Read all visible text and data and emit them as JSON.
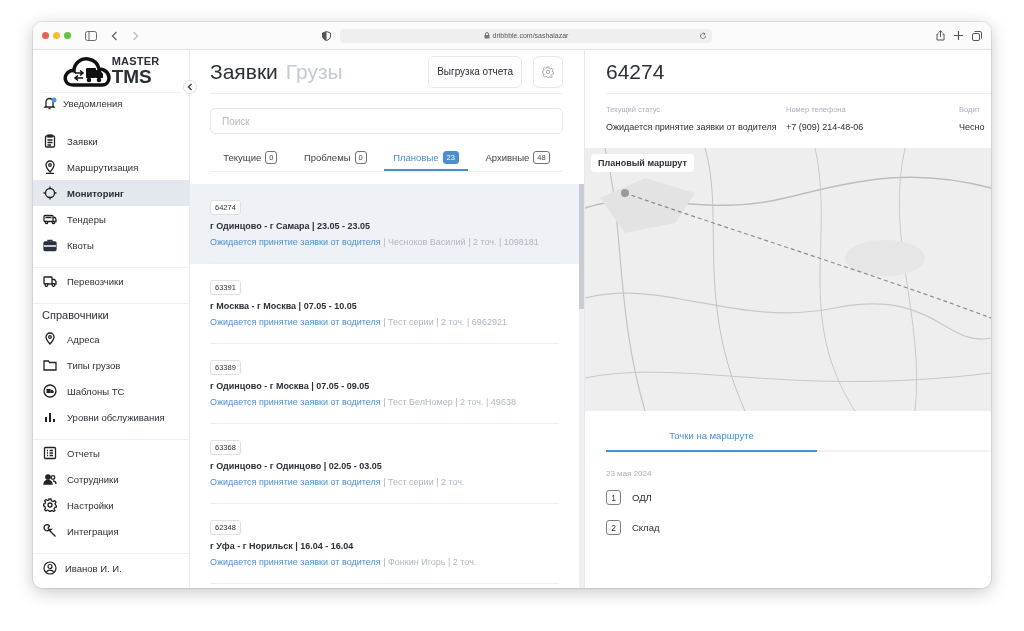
{
  "browser": {
    "url": "dribbble.com/sashalazar"
  },
  "sidebar": {
    "logo": {
      "line1": "MASTER",
      "line2": "TMS"
    },
    "notifications": {
      "label": "Уведомления"
    },
    "groups": [
      {
        "items": [
          {
            "label": "Заявки",
            "selected": false
          },
          {
            "label": "Маршрутизация",
            "selected": false
          },
          {
            "label": "Мониторинг",
            "selected": true
          },
          {
            "label": "Тендеры",
            "selected": false
          },
          {
            "label": "Квоты",
            "selected": false
          }
        ]
      },
      {
        "items": [
          {
            "label": "Перевозчики",
            "selected": false
          }
        ]
      },
      {
        "heading": "Справочники",
        "items": [
          {
            "label": "Адреса",
            "selected": false
          },
          {
            "label": "Типы грузов",
            "selected": false
          },
          {
            "label": "Шаблоны ТС",
            "selected": false
          },
          {
            "label": "Уровни обслуживания",
            "selected": false
          }
        ]
      },
      {
        "items": [
          {
            "label": "Отчеты",
            "selected": false
          },
          {
            "label": "Сотрудники",
            "selected": false
          },
          {
            "label": "Настройки",
            "selected": false
          },
          {
            "label": "Интеграция",
            "selected": false
          }
        ]
      }
    ],
    "user": {
      "name": "Иванов И. И."
    }
  },
  "list_panel": {
    "sections": [
      {
        "label": "Заявки",
        "selected": true
      },
      {
        "label": "Грузы",
        "selected": false
      }
    ],
    "export_button": "Выгрузка отчета",
    "search": {
      "placeholder": "Поиск"
    },
    "tabs": [
      {
        "label": "Текущие",
        "count": "0",
        "selected": false
      },
      {
        "label": "Проблемы",
        "count": "0",
        "selected": false
      },
      {
        "label": "Плановые",
        "count": "23",
        "selected": true
      },
      {
        "label": "Архивные",
        "count": "48",
        "selected": false
      }
    ],
    "orders": [
      {
        "id": "64274",
        "route": "г Одинцово - г Самара | 23.05 - 23.05",
        "status": "Ожидается принятие заявки от водителя",
        "details": "| Чесноков Василий | 2 точ. | 1098181",
        "selected": true
      },
      {
        "id": "63391",
        "route": "г Москва - г Москва | 07.05 - 10.05",
        "status": "Ожидается принятие заявки от водителя",
        "details": "| Тест серии | 2 точ. | 6962921",
        "selected": false
      },
      {
        "id": "63389",
        "route": "г Одинцово - г Москва | 07.05 - 09.05",
        "status": "Ожидается принятие заявки от водителя",
        "details": "| Тест БелНомер | 2 точ. | 49638",
        "selected": false
      },
      {
        "id": "63368",
        "route": "г Одинцово - г Одинцово | 02.05 - 03.05",
        "status": "Ожидается принятие заявки от водителя",
        "details": "| Тест серии | 2 точ.",
        "selected": false
      },
      {
        "id": "62348",
        "route": "г Уфа - г Норильск | 16.04 - 16.04",
        "status": "Ожидается принятие заявки от водителя",
        "details": "| Фонкин Игорь | 2 точ.",
        "selected": false
      }
    ]
  },
  "detail": {
    "title": "64274",
    "fields": [
      {
        "label": "Текущий статус",
        "value": "Ожидается принятие заявки от водителя"
      },
      {
        "label": "Номер телефона",
        "value": "+7 (909) 214-48-06"
      },
      {
        "label": "Водит",
        "value": "Чесно"
      }
    ],
    "map": {
      "kind": "picture",
      "overlay": "Плановый маршрут"
    },
    "tabs": [
      {
        "label": "Точки на маршруте",
        "selected": true
      }
    ],
    "date": "23 мая 2024",
    "points": [
      {
        "number": "1",
        "name": "ОДЛ"
      },
      {
        "number": "2",
        "name": "Склад"
      }
    ]
  }
}
